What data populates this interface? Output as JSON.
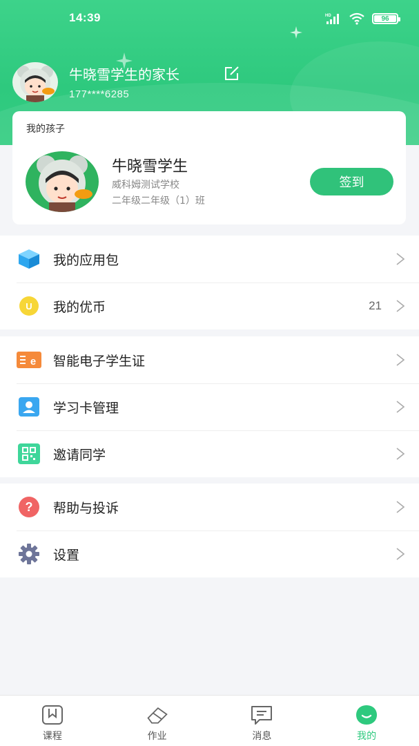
{
  "status_bar": {
    "time": "14:39",
    "signal": "HD",
    "battery": "96"
  },
  "profile": {
    "name": "牛晓雪学生的家长",
    "phone": "177****6285"
  },
  "child_card": {
    "title": "我的孩子",
    "child_name": "牛晓雪学生",
    "school": "威科姆测试学校",
    "class": "二年级二年级（1）班",
    "checkin_label": "签到"
  },
  "menu": {
    "group1": [
      {
        "label": "我的应用包",
        "icon": "cube-icon"
      },
      {
        "label": "我的优币",
        "icon": "coin-icon",
        "value": "21"
      }
    ],
    "group2": [
      {
        "label": "智能电子学生证",
        "icon": "student-card-icon"
      },
      {
        "label": "学习卡管理",
        "icon": "person-card-icon"
      },
      {
        "label": "邀请同学",
        "icon": "qr-code-icon"
      }
    ],
    "group3": [
      {
        "label": "帮助与投诉",
        "icon": "question-icon"
      },
      {
        "label": "设置",
        "icon": "gear-icon"
      }
    ]
  },
  "tabbar": {
    "tabs": [
      {
        "label": "课程",
        "icon": "bookmark-icon"
      },
      {
        "label": "作业",
        "icon": "eraser-icon"
      },
      {
        "label": "消息",
        "icon": "message-icon"
      },
      {
        "label": "我的",
        "icon": "smile-icon",
        "active": true
      }
    ]
  },
  "colors": {
    "brand": "#2ec97e",
    "background": "#f4f5f8"
  }
}
